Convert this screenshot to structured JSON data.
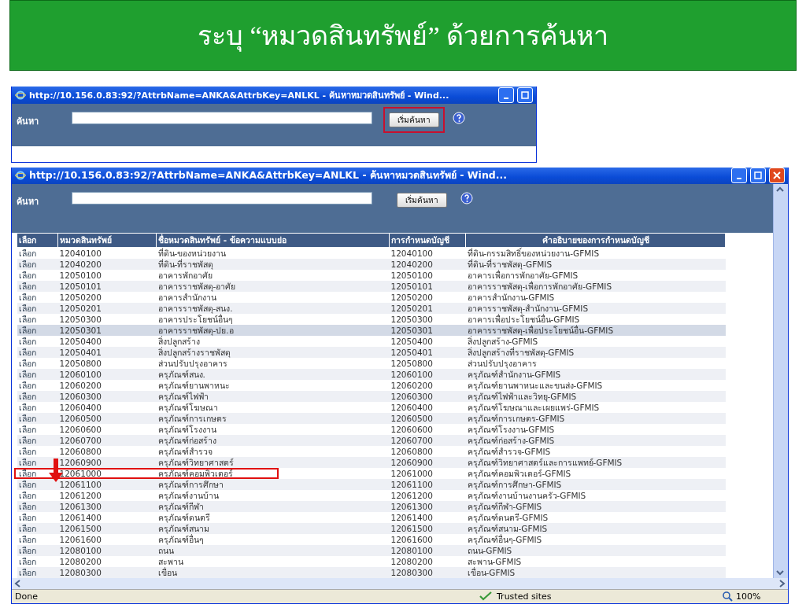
{
  "slide_title": "ระบุ “หมวดสินทรัพย์” ด้วยการค้นหา",
  "back_window": {
    "title": "http://10.156.0.83:92/?AttrbName=ANKA&AttrbKey=ANLKL - ค้นหาหมวดสินทรัพย์ - Wind...",
    "search_label": "ค้นหา",
    "search_button": {
      "label": "เริ่มค้นหา",
      "boxed": true
    }
  },
  "front_window": {
    "title": "http://10.156.0.83:92/?AttrbName=ANKA&AttrbKey=ANLKL - ค้นหาหมวดสินทรัพย์ - Wind...",
    "search_label": "ค้นหา",
    "search_button": {
      "label": "เริ่มค้นหา",
      "boxed": false
    },
    "table": {
      "columns": [
        "เลือก",
        "หมวดสินทรัพย์",
        "ชื่อหมวดสินทรัพย์ - ข้อความแบบย่อ",
        "การกำหนดบัญชี",
        "คำอธิบายของการกำหนดบัญชี"
      ],
      "rows": [
        {
          "action": "เลือก",
          "code": "12040100",
          "name": "ที่ดิน-ของหน่วยงาน",
          "account": "12040100",
          "description": "ที่ดิน-กรรมสิทธิ์ของหน่วยงาน-GFMIS",
          "selected": false,
          "boxed": false
        },
        {
          "action": "เลือก",
          "code": "12040200",
          "name": "ที่ดิน-ที่ราชพัสดุ",
          "account": "12040200",
          "description": "ที่ดิน-ที่ราชพัสดุ-GFMIS",
          "selected": false,
          "boxed": false
        },
        {
          "action": "เลือก",
          "code": "12050100",
          "name": "อาคารพักอาศัย",
          "account": "12050100",
          "description": "อาคารเพื่อการพักอาศัย-GFMIS",
          "selected": false,
          "boxed": false
        },
        {
          "action": "เลือก",
          "code": "12050101",
          "name": "อาคารราชพัสดุ-อาศัย",
          "account": "12050101",
          "description": "อาคารราชพัสดุ-เพื่อการพักอาศัย-GFMIS",
          "selected": false,
          "boxed": false
        },
        {
          "action": "เลือก",
          "code": "12050200",
          "name": "อาคารสำนักงาน",
          "account": "12050200",
          "description": "อาคารสำนักงาน-GFMIS",
          "selected": false,
          "boxed": false
        },
        {
          "action": "เลือก",
          "code": "12050201",
          "name": "อาคารราชพัสดุ-สนง.",
          "account": "12050201",
          "description": "อาคารราชพัสดุ-สำนักงาน-GFMIS",
          "selected": false,
          "boxed": false
        },
        {
          "action": "เลือก",
          "code": "12050300",
          "name": "อาคารประโยชน์อื่นๆ",
          "account": "12050300",
          "description": "อาคารเพื่อประโยชน์อื่น-GFMIS",
          "selected": false,
          "boxed": false
        },
        {
          "action": "เลือก",
          "code": "12050301",
          "name": "อาคารราชพัสดุ-ปย.อ",
          "account": "12050301",
          "description": "อาคารราชพัสดุ-เพื่อประโยชน์อื่น-GFMIS",
          "selected": true,
          "boxed": false
        },
        {
          "action": "เลือก",
          "code": "12050400",
          "name": "สิ่งปลูกสร้าง",
          "account": "12050400",
          "description": "สิ่งปลูกสร้าง-GFMIS",
          "selected": false,
          "boxed": false
        },
        {
          "action": "เลือก",
          "code": "12050401",
          "name": "สิ่งปลูกสร้างราชพัสดุ",
          "account": "12050401",
          "description": "สิ่งปลูกสร้างที่ราชพัสดุ-GFMIS",
          "selected": false,
          "boxed": false
        },
        {
          "action": "เลือก",
          "code": "12050800",
          "name": "ส่วนปรับปรุงอาคาร",
          "account": "12050800",
          "description": "ส่วนปรับปรุงอาคาร",
          "selected": false,
          "boxed": false
        },
        {
          "action": "เลือก",
          "code": "12060100",
          "name": "ครุภัณฑ์สนง.",
          "account": "12060100",
          "description": "ครุภัณฑ์สำนักงาน-GFMIS",
          "selected": false,
          "boxed": false
        },
        {
          "action": "เลือก",
          "code": "12060200",
          "name": "ครุภัณฑ์ยานพาหนะ",
          "account": "12060200",
          "description": "ครุภัณฑ์ยานพาหนะและขนส่ง-GFMIS",
          "selected": false,
          "boxed": false
        },
        {
          "action": "เลือก",
          "code": "12060300",
          "name": "ครุภัณฑ์ไฟฟ้า",
          "account": "12060300",
          "description": "ครุภัณฑ์ไฟฟ้าและวิทยุ-GFMIS",
          "selected": false,
          "boxed": false
        },
        {
          "action": "เลือก",
          "code": "12060400",
          "name": "ครุภัณฑ์โฆษณา",
          "account": "12060400",
          "description": "ครุภัณฑ์โฆษณาและเผยแพร่-GFMIS",
          "selected": false,
          "boxed": false
        },
        {
          "action": "เลือก",
          "code": "12060500",
          "name": "ครุภัณฑ์การเกษตร",
          "account": "12060500",
          "description": "ครุภัณฑ์การเกษตร-GFMIS",
          "selected": false,
          "boxed": false
        },
        {
          "action": "เลือก",
          "code": "12060600",
          "name": "ครุภัณฑ์โรงงาน",
          "account": "12060600",
          "description": "ครุภัณฑ์โรงงาน-GFMIS",
          "selected": false,
          "boxed": false
        },
        {
          "action": "เลือก",
          "code": "12060700",
          "name": "ครุภัณฑ์ก่อสร้าง",
          "account": "12060700",
          "description": "ครุภัณฑ์ก่อสร้าง-GFMIS",
          "selected": false,
          "boxed": false
        },
        {
          "action": "เลือก",
          "code": "12060800",
          "name": "ครุภัณฑ์สำรวจ",
          "account": "12060800",
          "description": "ครุภัณฑ์สำรวจ-GFMIS",
          "selected": false,
          "boxed": false
        },
        {
          "action": "เลือก",
          "code": "12060900",
          "name": "ครุภัณฑ์วิทยาศาสตร์",
          "account": "12060900",
          "description": "ครุภัณฑ์วิทยาศาสตร์และการแพทย์-GFMIS",
          "selected": false,
          "boxed": false
        },
        {
          "action": "เลือก",
          "code": "12061000",
          "name": "ครุภัณฑ์คอมพิวเตอร์",
          "account": "12061000",
          "description": "ครุภัณฑ์คอมพิวเตอร์-GFMIS",
          "selected": false,
          "boxed": true
        },
        {
          "action": "เลือก",
          "code": "12061100",
          "name": "ครุภัณฑ์การศึกษา",
          "account": "12061100",
          "description": "ครุภัณฑ์การศึกษา-GFMIS",
          "selected": false,
          "boxed": false
        },
        {
          "action": "เลือก",
          "code": "12061200",
          "name": "ครุภัณฑ์งานบ้าน",
          "account": "12061200",
          "description": "ครุภัณฑ์งานบ้านงานครัว-GFMIS",
          "selected": false,
          "boxed": false
        },
        {
          "action": "เลือก",
          "code": "12061300",
          "name": "ครุภัณฑ์กีฬา",
          "account": "12061300",
          "description": "ครุภัณฑ์กีฬา-GFMIS",
          "selected": false,
          "boxed": false
        },
        {
          "action": "เลือก",
          "code": "12061400",
          "name": "ครุภัณฑ์ดนตรี",
          "account": "12061400",
          "description": "ครุภัณฑ์ดนตรี-GFMIS",
          "selected": false,
          "boxed": false
        },
        {
          "action": "เลือก",
          "code": "12061500",
          "name": "ครุภัณฑ์สนาม",
          "account": "12061500",
          "description": "ครุภัณฑ์สนาม-GFMIS",
          "selected": false,
          "boxed": false
        },
        {
          "action": "เลือก",
          "code": "12061600",
          "name": "ครุภัณฑ์อื่นๆ",
          "account": "12061600",
          "description": "ครุภัณฑ์อื่นๆ-GFMIS",
          "selected": false,
          "boxed": false
        },
        {
          "action": "เลือก",
          "code": "12080100",
          "name": "ถนน",
          "account": "12080100",
          "description": "ถนน-GFMIS",
          "selected": false,
          "boxed": false
        },
        {
          "action": "เลือก",
          "code": "12080200",
          "name": "สะพาน",
          "account": "12080200",
          "description": "สะพาน-GFMIS",
          "selected": false,
          "boxed": false
        },
        {
          "action": "เลือก",
          "code": "12080300",
          "name": "เขื่อน",
          "account": "12080300",
          "description": "เขื่อน-GFMIS",
          "selected": false,
          "boxed": false
        }
      ]
    },
    "status_bar": {
      "text": "Done",
      "zone": "Trusted sites",
      "zoom": "100%"
    }
  }
}
